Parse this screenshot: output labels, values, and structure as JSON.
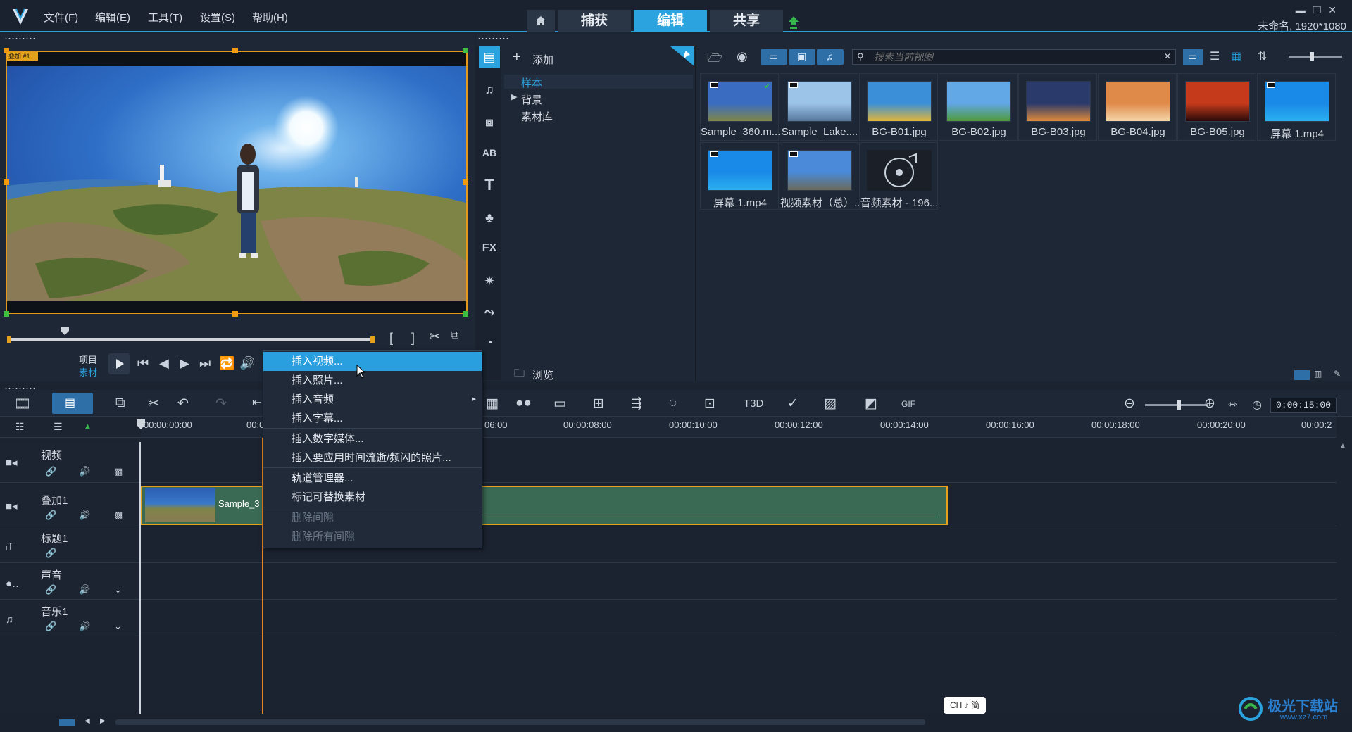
{
  "app": {
    "menu": [
      "文件(F)",
      "编辑(E)",
      "工具(T)",
      "设置(S)",
      "帮助(H)"
    ],
    "mode_tabs": [
      "捕获",
      "编辑",
      "共享"
    ],
    "active_tab": "编辑",
    "project_info": "未命名, 1920*1080",
    "accent": "#2aa3de"
  },
  "preview": {
    "overlay_label": "叠加 #1",
    "mode_project": "项目",
    "mode_clip": "素材"
  },
  "library": {
    "add_label": "添加",
    "folders": [
      {
        "label": "样本",
        "selected": true
      },
      {
        "label": "背景",
        "selected": false,
        "expandable": true
      },
      {
        "label": "素材库",
        "selected": false
      }
    ],
    "browse_label": "浏览",
    "search_placeholder": "搜索当前视图",
    "items": [
      {
        "label": "Sample_360.m...",
        "kind": "video",
        "checked": true
      },
      {
        "label": "Sample_Lake....",
        "kind": "video"
      },
      {
        "label": "BG-B01.jpg",
        "kind": "image"
      },
      {
        "label": "BG-B02.jpg",
        "kind": "image"
      },
      {
        "label": "BG-B03.jpg",
        "kind": "image"
      },
      {
        "label": "BG-B04.jpg",
        "kind": "image"
      },
      {
        "label": "BG-B05.jpg",
        "kind": "image"
      },
      {
        "label": "屏幕 1.mp4",
        "kind": "video"
      },
      {
        "label": "屏幕 1.mp4",
        "kind": "video"
      },
      {
        "label": "视频素材（总）....",
        "kind": "video"
      },
      {
        "label": "音频素材 - 196...",
        "kind": "audio"
      }
    ]
  },
  "timeline": {
    "timecode": "0:00:15:00",
    "ruler": [
      "00:00:00:00",
      "00:0",
      "06:00",
      "00:00:08:00",
      "00:00:10:00",
      "00:00:12:00",
      "00:00:14:00",
      "00:00:16:00",
      "00:00:18:00",
      "00:00:20:00",
      "00:00:2"
    ],
    "tracks": [
      {
        "name": "视频"
      },
      {
        "name": "叠加1"
      },
      {
        "name": "标题1"
      },
      {
        "name": "声音"
      },
      {
        "name": "音乐1"
      }
    ],
    "clip_label": "Sample_3",
    "ime_label": "CH ♪ 简"
  },
  "context_menu": {
    "items": [
      {
        "label": "插入视频...",
        "state": "active"
      },
      {
        "label": "插入照片...",
        "state": "normal"
      },
      {
        "label": "插入音频",
        "state": "submenu"
      },
      {
        "label": "插入字幕...",
        "state": "normal"
      },
      {
        "label": "插入数字媒体...",
        "state": "normal"
      },
      {
        "label": "插入要应用时间流逝/频闪的照片...",
        "state": "normal"
      },
      {
        "label": "轨道管理器...",
        "state": "normal"
      },
      {
        "label": "标记可替换素材",
        "state": "normal"
      },
      {
        "label": "删除间隙",
        "state": "disabled"
      },
      {
        "label": "删除所有间隙",
        "state": "disabled"
      }
    ]
  },
  "watermark": {
    "text": "极光下载站",
    "url_text": "www.xz7.com"
  }
}
